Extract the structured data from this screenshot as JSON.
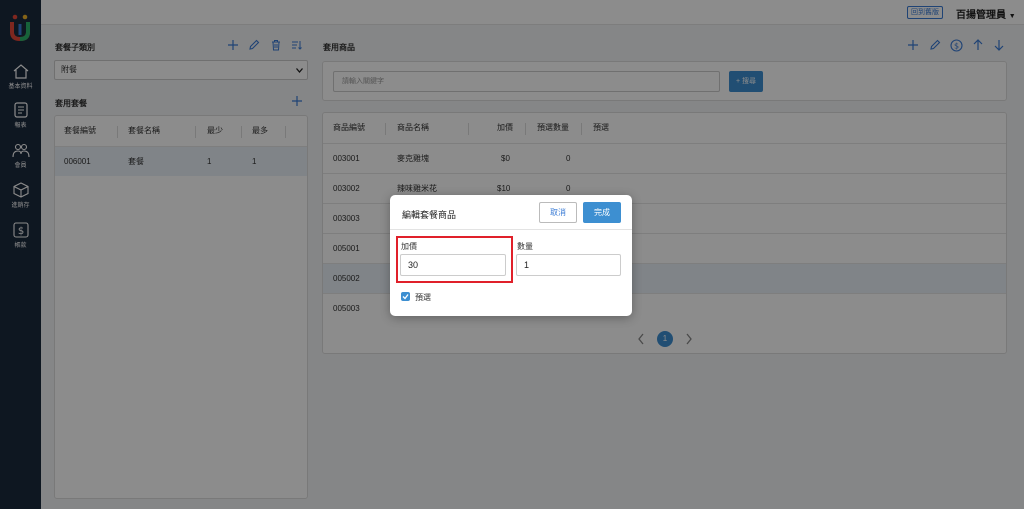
{
  "app": {
    "logo_letter": "U"
  },
  "sidebar": {
    "items": [
      {
        "label": "基本資料",
        "icon": "home-icon"
      },
      {
        "label": "報表",
        "icon": "report-icon"
      },
      {
        "label": "會員",
        "icon": "members-icon"
      },
      {
        "label": "進銷存",
        "icon": "inventory-box-icon"
      },
      {
        "label": "帳款",
        "icon": "dollar-icon"
      }
    ]
  },
  "topbar": {
    "back_label": "回到舊版",
    "user_name": "百揚管理員"
  },
  "left": {
    "subcategory_title": "套餐子類別",
    "subcategory_selected": "附餐",
    "combo_title": "套用套餐",
    "columns": [
      "套餐編號",
      "套餐名稱",
      "最少",
      "最多"
    ],
    "rows": [
      {
        "id": "006001",
        "name": "套餐",
        "min": "1",
        "max": "1"
      }
    ]
  },
  "right": {
    "title": "套用商品",
    "search_placeholder": "請輸入關鍵字",
    "search_button": "+ 搜尋",
    "columns": [
      "商品編號",
      "商品名稱",
      "加價",
      "預選數量",
      "預選"
    ],
    "rows": [
      {
        "id": "003001",
        "name": "麥克雞塊",
        "price": "$0",
        "qty": "0"
      },
      {
        "id": "003002",
        "name": "辣味雞米花",
        "price": "$10",
        "qty": "0"
      },
      {
        "id": "003003",
        "name": "",
        "price": "",
        "qty": ""
      },
      {
        "id": "005001",
        "name": "",
        "price": "",
        "qty": ""
      },
      {
        "id": "005002",
        "name": "",
        "price": "",
        "qty": ""
      },
      {
        "id": "005003",
        "name": "",
        "price": "",
        "qty": ""
      }
    ],
    "page": "1"
  },
  "dialog": {
    "title": "編輯套餐商品",
    "cancel_label": "取消",
    "done_label": "完成",
    "price_label": "加價",
    "price_value": "30",
    "qty_label": "數量",
    "qty_value": "1",
    "preselect_label": "預選"
  },
  "colors": {
    "sidebar": "#1b2a3d",
    "accent": "#3d8fd1",
    "highlight": "#e0202a"
  }
}
